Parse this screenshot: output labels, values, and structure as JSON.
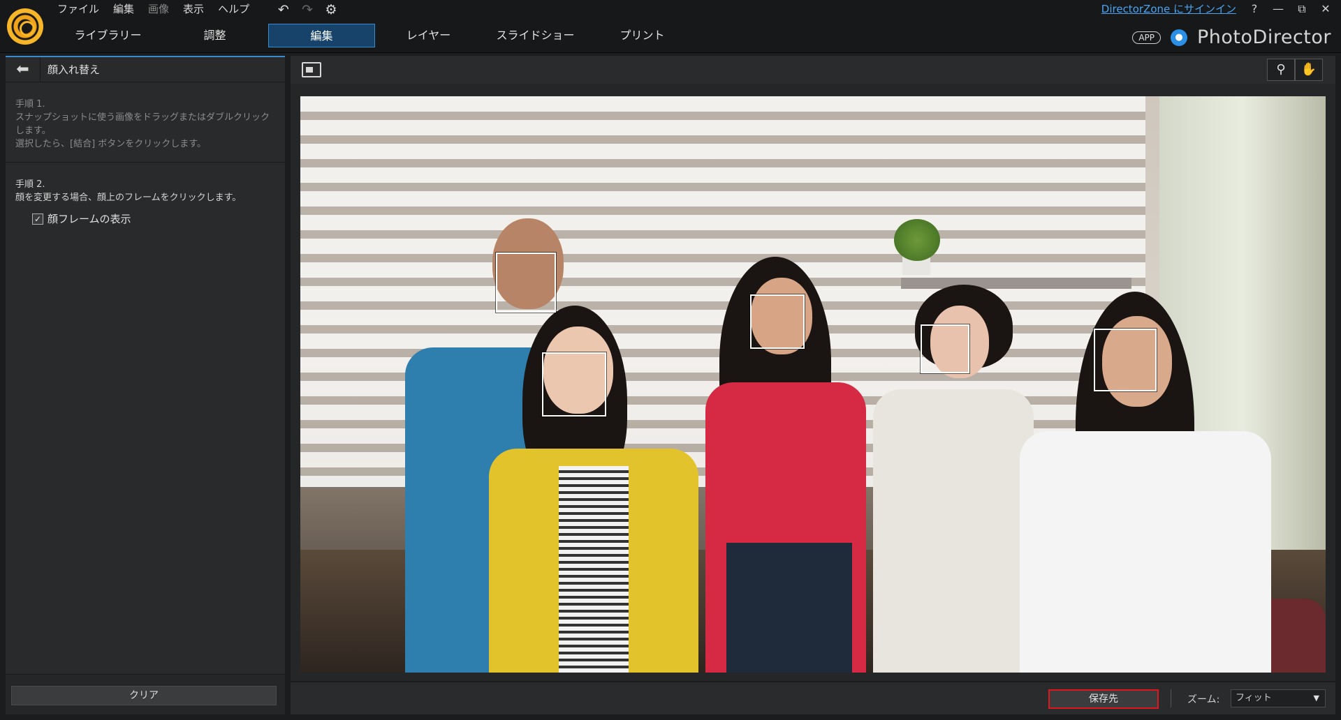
{
  "menu": [
    "ファイル",
    "編集",
    "画像",
    "表示",
    "ヘルプ"
  ],
  "modes": [
    "ライブラリー",
    "調整",
    "編集",
    "レイヤー",
    "スライドショー",
    "プリント"
  ],
  "active_mode": "編集",
  "top_right": {
    "signin": "DirectorZone にサインイン",
    "help": "?",
    "minimize": "—",
    "restore": "⧉",
    "close": "✕",
    "app_badge": "APP",
    "brand": "PhotoDirector"
  },
  "left_panel": {
    "title": "顔入れ替え",
    "step1_heading": "手順 1.",
    "step1_line1": "スナップショットに使う画像をドラッグまたはダブルクリックします。",
    "step1_line2": "選択したら、[結合] ボタンをクリックします。",
    "step2_heading": "手順 2.",
    "step2_line1": "顔を変更する場合、顔上のフレームをクリックします。",
    "checkbox_label": "顔フレームの表示",
    "checkbox_checked": true,
    "clear_label": "クリア"
  },
  "bottom": {
    "save_label": "保存先",
    "zoom_label": "ズーム:",
    "zoom_value": "フィット"
  },
  "icons": {
    "back": "arrow-left-icon",
    "undo": "undo-icon",
    "redo": "redo-icon",
    "settings": "gear-icon",
    "zoom": "magnifier-icon",
    "pan": "hand-icon",
    "compare": "compare-view-icon",
    "notification": "bell-icon"
  },
  "colors": {
    "accent": "#3a8ad0",
    "save_highlight": "#e0161c",
    "link": "#4aa4f2"
  }
}
